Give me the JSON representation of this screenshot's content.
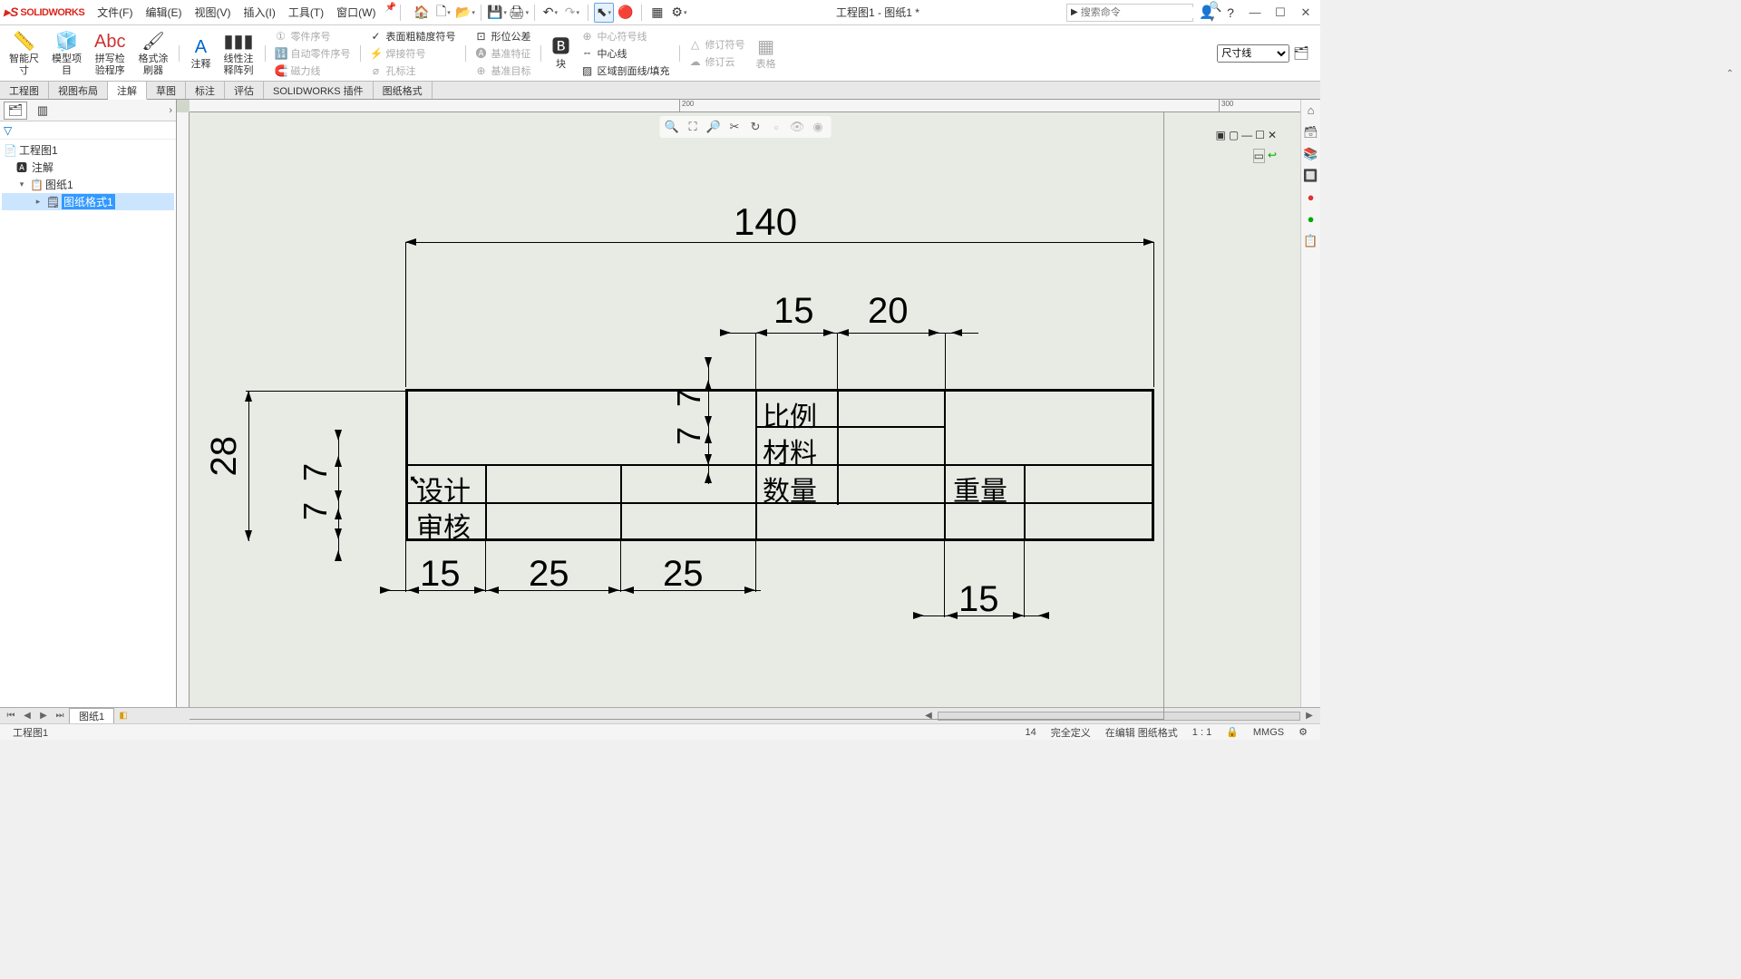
{
  "app": {
    "name": "SOLIDWORKS",
    "title": "工程图1 - 图纸1 *"
  },
  "menu": {
    "file": "文件(F)",
    "edit": "编辑(E)",
    "view": "视图(V)",
    "insert": "插入(I)",
    "tools": "工具(T)",
    "window": "窗口(W)"
  },
  "search": {
    "placeholder": "搜索命令"
  },
  "ribbon": {
    "smart_dim": "智能尺\n寸",
    "model_item": "模型项\n目",
    "spell": "拼写检\n验程序",
    "painter": "格式涂\n刷器",
    "note": "注释",
    "linear_pattern": "线性注\n释阵列",
    "balloon": "零件序号",
    "auto_balloon": "自动零件序号",
    "magnet": "磁力线",
    "surface_finish": "表面粗糙度符号",
    "weld": "焊接符号",
    "hole_callout": "孔标注",
    "geo_tol": "形位公差",
    "datum_feat": "基准特征",
    "datum_target": "基准目标",
    "block": "块",
    "center_mark": "中心符号线",
    "centerline": "中心线",
    "area_hatch": "区域剖面线/填充",
    "rev_symbol": "修订符号",
    "rev_cloud": "修订云",
    "tables": "表格",
    "layer": "尺寸线"
  },
  "tabs": {
    "drawing": "工程图",
    "layout": "视图布局",
    "annotate": "注解",
    "sketch": "草图",
    "markup": "标注",
    "evaluate": "评估",
    "addins": "SOLIDWORKS 插件",
    "sheet_format": "图纸格式"
  },
  "tree": {
    "root": "工程图1",
    "ann": "注解",
    "sheet": "图纸1",
    "format": "图纸格式1"
  },
  "titleblock": {
    "design": "设计",
    "check": "审核",
    "scale_lbl": "比例",
    "material": "材料",
    "qty": "数量",
    "weight": "重量"
  },
  "dims": {
    "d140": "140",
    "d15a": "15",
    "d20": "20",
    "d7a": "7",
    "d7b": "7",
    "d28": "28",
    "d7c": "7",
    "d7d": "7",
    "d15b": "15",
    "d25a": "25",
    "d25b": "25",
    "d15c": "15"
  },
  "ruler": {
    "t200": "200",
    "t300": "300"
  },
  "sheets": {
    "sheet1": "图纸1"
  },
  "status": {
    "left": "工程图1",
    "coord": "14",
    "def": "完全定义",
    "mode": "在编辑 图纸格式",
    "ratio": "1 : 1",
    "units": "MMGS"
  }
}
